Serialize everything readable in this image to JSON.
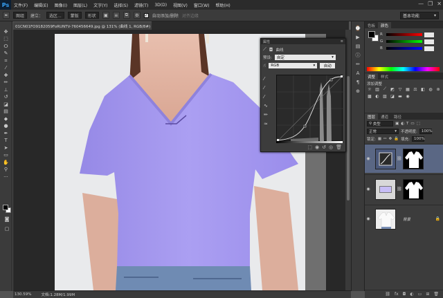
{
  "app": {
    "logo": "Ps"
  },
  "menu": [
    "文件(F)",
    "编辑(E)",
    "图像(I)",
    "图层(L)",
    "文字(Y)",
    "选择(S)",
    "滤镜(T)",
    "3D(D)",
    "视图(V)",
    "窗口(W)",
    "帮助(H)"
  ],
  "window_controls": [
    "—",
    "❐",
    "✕"
  ],
  "options_bar": {
    "group_select": "图组",
    "align_label": "建立：",
    "selection_btn": "选区...",
    "mask_btn": "蒙版",
    "shape_btn": "形状",
    "auto_add_delete": "自动添加/删除",
    "align_edges": "对齐边缘",
    "workspace": "基本功能"
  },
  "document": {
    "tab_title": "01CN01FO9182059FoRUNTV-760456649.jpg @ 131% (曲线 1, RGB/8#) *",
    "zoom": "130.59%",
    "doc_size": "文档:1.28M/1.99M"
  },
  "properties_panel": {
    "title": "属性",
    "adjustment_name": "曲线",
    "preset_label": "预设:",
    "preset_value": "自定",
    "channel_value": "RGB",
    "auto_button": "自动"
  },
  "colors_panel": {
    "tabs": [
      "色板",
      "颜色"
    ],
    "sliders": [
      {
        "label": "R",
        "value": ""
      },
      {
        "label": "G",
        "value": ""
      },
      {
        "label": "B",
        "value": ""
      }
    ]
  },
  "adjustments_panel": {
    "tabs": [
      "调整",
      "样式"
    ],
    "title": "添加调整"
  },
  "layers_panel": {
    "tabs": [
      "图层",
      "通道",
      "路径"
    ],
    "kind_filter": "类型",
    "blend_mode": "正常",
    "opacity_label": "不透明度:",
    "opacity_value": "100%",
    "lock_label": "锁定:",
    "fill_label": "填充:",
    "fill_value": "100%",
    "layers": [
      {
        "name": "",
        "type": "curves-adjustment",
        "selected": true
      },
      {
        "name": "",
        "type": "solid-color-fill",
        "selected": false
      },
      {
        "name": "背景",
        "type": "photo",
        "selected": false
      }
    ]
  },
  "accent_colors": {
    "shirt": "#a99cf0",
    "panel": "#3c3c3c",
    "selected_layer": "#5a6784"
  }
}
